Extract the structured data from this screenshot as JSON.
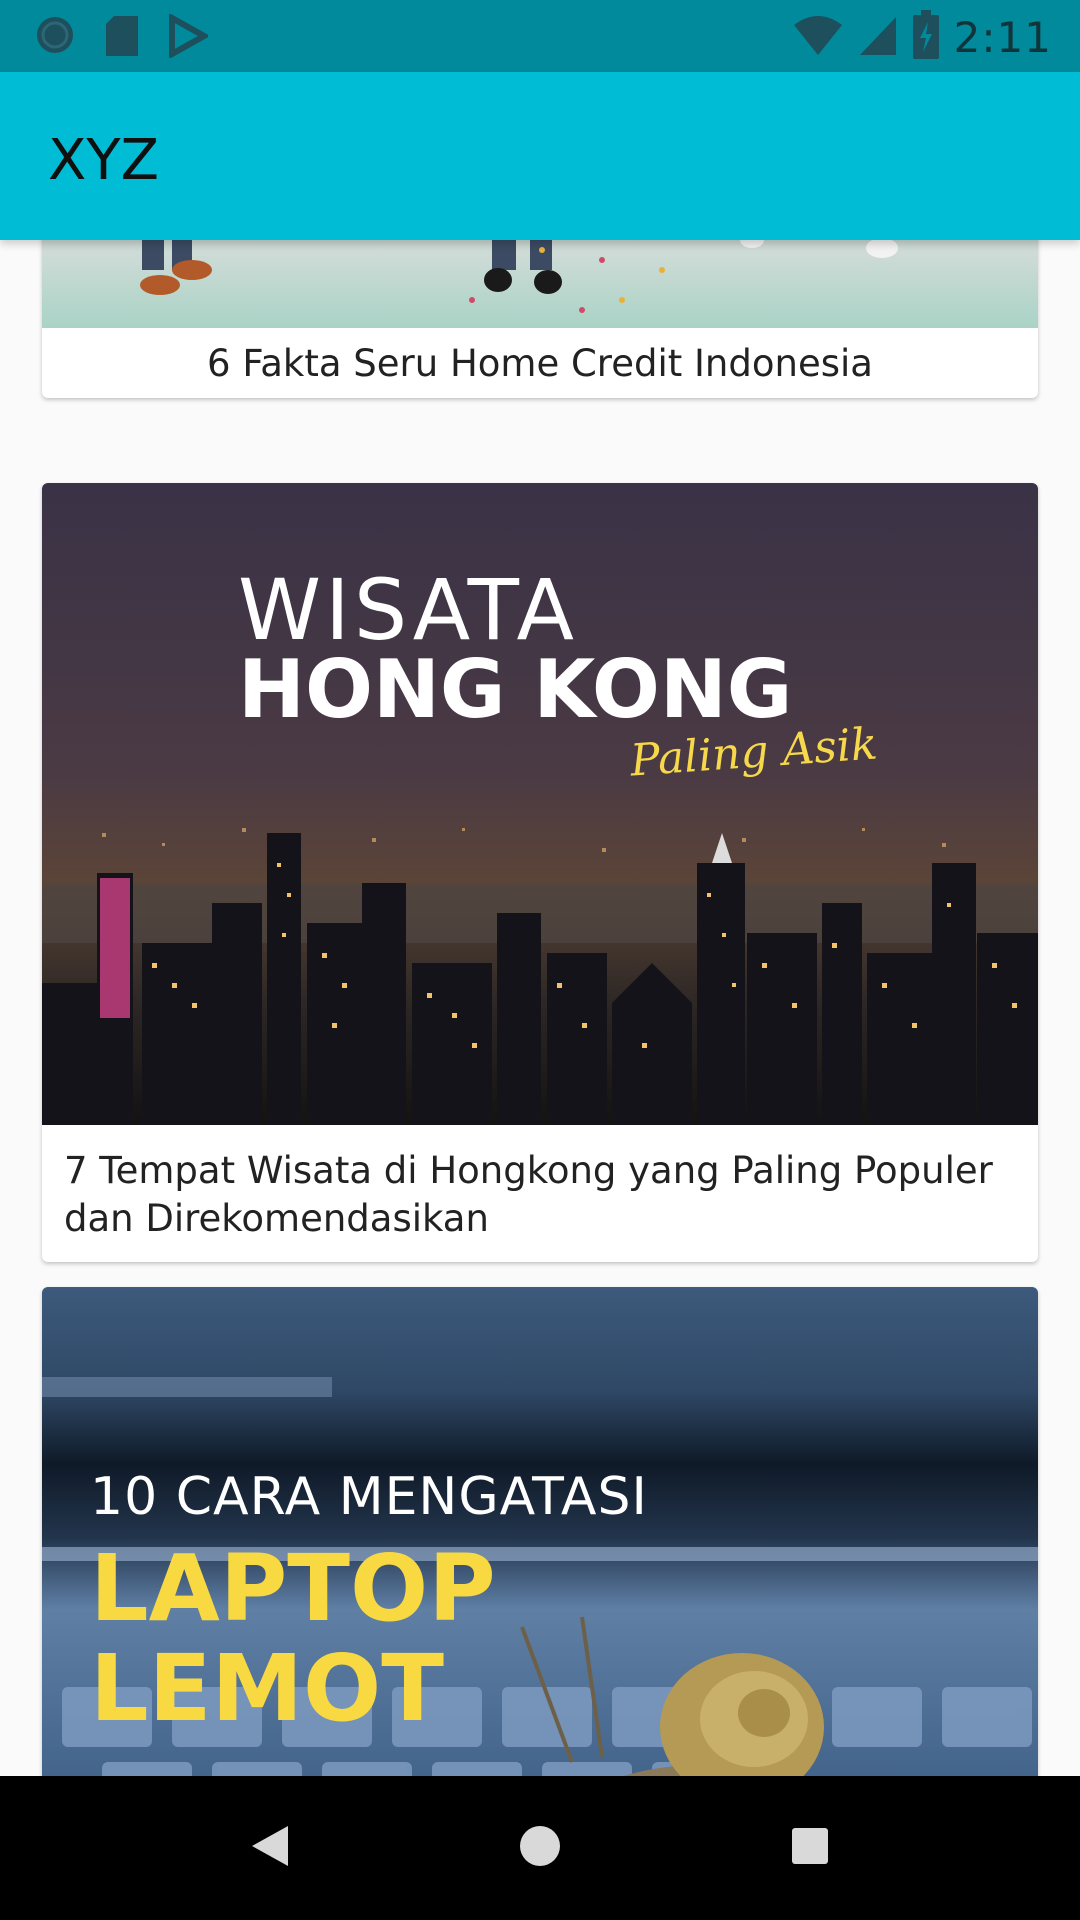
{
  "status_bar": {
    "time": "2:11",
    "left_icons": [
      "sync-icon",
      "sd-card-icon",
      "play-store-icon"
    ],
    "right_icons": [
      "wifi-icon",
      "signal-icon",
      "battery-charging-icon"
    ]
  },
  "app_bar": {
    "title": "XYZ",
    "color": "#00bcd4"
  },
  "feed": {
    "cards": [
      {
        "title": "6 Fakta Seru Home Credit Indonesia"
      },
      {
        "title": "7 Tempat Wisata di Hongkong yang Paling Populer dan Direkomendasikan",
        "image_text": {
          "line1": "WISATA",
          "line2": "HONG KONG",
          "line3": "Paling Asik"
        }
      },
      {
        "image_text": {
          "line1": "10 CARA MENGATASI",
          "line2": "LAPTOP",
          "line3": "LEMOT"
        }
      }
    ]
  },
  "nav_bar": {
    "buttons": [
      "back-icon",
      "home-icon",
      "recents-icon"
    ]
  }
}
